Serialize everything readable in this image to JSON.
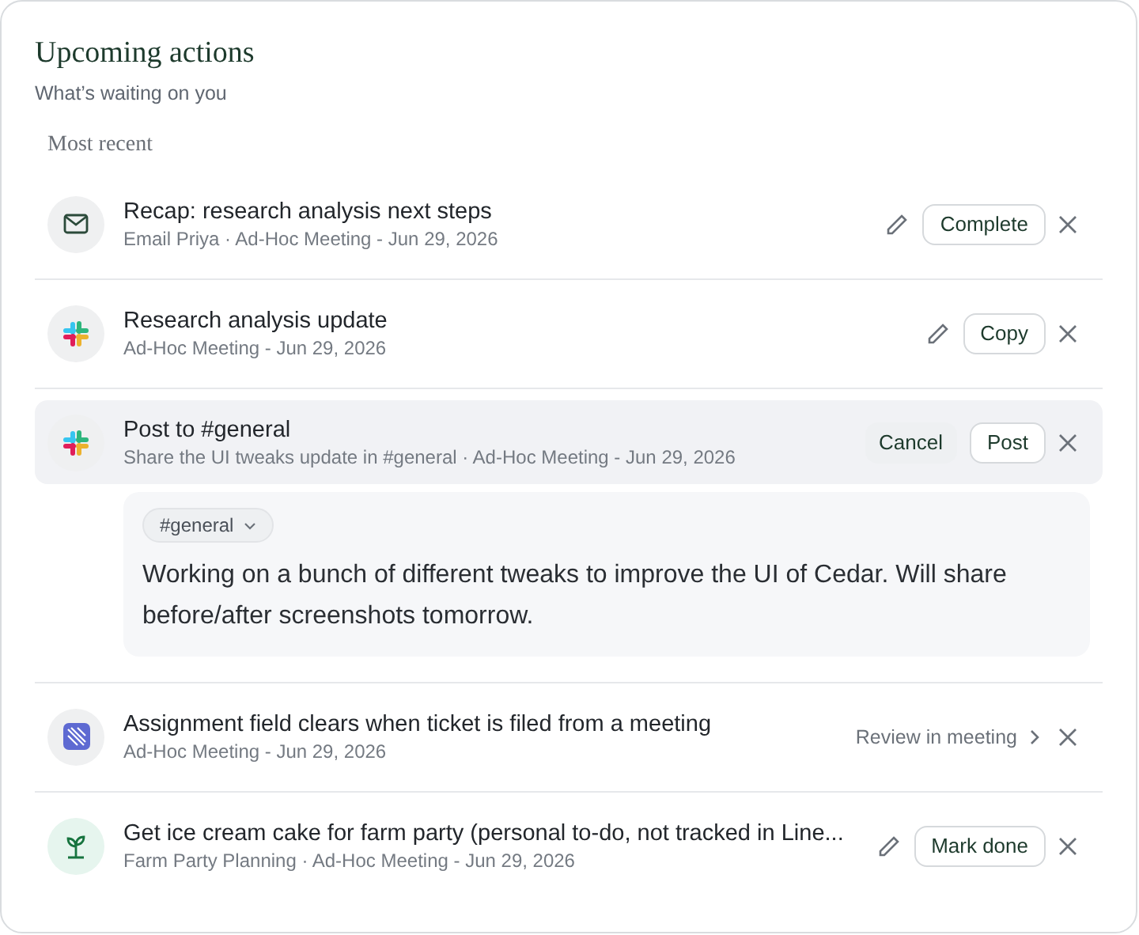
{
  "header": {
    "title": "Upcoming actions",
    "subtitle": "What’s waiting on you"
  },
  "section": {
    "label": "Most recent"
  },
  "actions": [
    {
      "kind": "mail",
      "title": "Recap: research analysis next steps",
      "meta": "Email Priya · Ad-Hoc Meeting - Jun 29, 2026",
      "expanded": false,
      "edit": true,
      "buttons": [
        {
          "kind": "outline",
          "label": "Complete"
        }
      ]
    },
    {
      "kind": "slack",
      "title": "Research analysis update",
      "meta": "Ad-Hoc Meeting - Jun 29, 2026",
      "expanded": false,
      "edit": true,
      "buttons": [
        {
          "kind": "outline",
          "label": "Copy"
        }
      ]
    },
    {
      "kind": "slack",
      "title": "Post to #general",
      "meta": "Share the UI tweaks update in #general · Ad-Hoc Meeting - Jun 29, 2026",
      "expanded": true,
      "edit": false,
      "buttons": [
        {
          "kind": "ghost",
          "label": "Cancel"
        },
        {
          "kind": "outline",
          "label": "Post"
        }
      ],
      "composer": {
        "channel": "#general",
        "message": "Working on a bunch of different tweaks to improve the UI of Cedar. Will share before/after screenshots tomorrow."
      }
    },
    {
      "kind": "linear",
      "title": "Assignment field clears when ticket is filed from a meeting",
      "meta": "Ad-Hoc Meeting - Jun 29, 2026",
      "expanded": false,
      "edit": false,
      "buttons": [
        {
          "kind": "link",
          "label": "Review in meeting"
        }
      ]
    },
    {
      "kind": "plant",
      "title": "Get ice cream cake for farm party (personal to-do, not tracked in Line...",
      "meta": "Farm Party Planning · Ad-Hoc Meeting - Jun 29, 2026",
      "expanded": false,
      "edit": true,
      "buttons": [
        {
          "kind": "outline",
          "label": "Mark done"
        }
      ]
    }
  ]
}
